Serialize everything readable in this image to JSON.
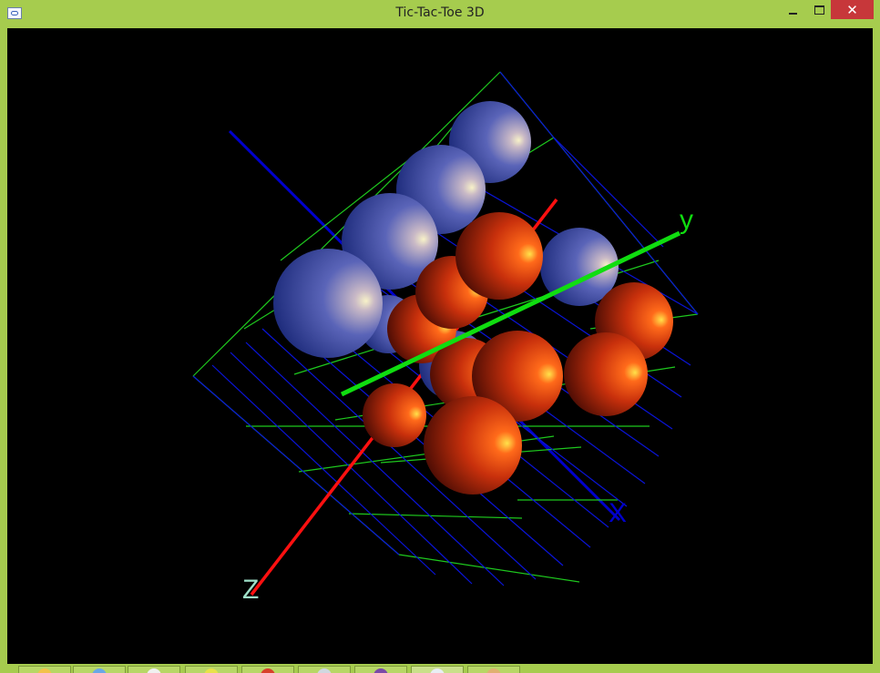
{
  "window": {
    "title": "Tic-Tac-Toe 3D",
    "controls": {
      "minimize": "minimize",
      "maximize": "maximize",
      "close": "✕"
    }
  },
  "scene": {
    "background": "#000000",
    "axis_labels": {
      "x": "X",
      "y": "y",
      "z": "Z"
    },
    "colors": {
      "x_axis": "#0000cc",
      "y_axis": "#00dd00",
      "z_axis": "#ff1010",
      "grid_blue": "#0a14d8",
      "grid_green": "#1ec81e",
      "player_blue": "#4a57b8",
      "player_red": "#d8300e"
    },
    "pieces": [
      {
        "player": "blue"
      },
      {
        "player": "blue"
      },
      {
        "player": "blue"
      },
      {
        "player": "blue"
      },
      {
        "player": "blue"
      },
      {
        "player": "blue"
      },
      {
        "player": "blue"
      },
      {
        "player": "red"
      },
      {
        "player": "red"
      },
      {
        "player": "red"
      },
      {
        "player": "red"
      },
      {
        "player": "red"
      },
      {
        "player": "red"
      },
      {
        "player": "red"
      },
      {
        "player": "red"
      },
      {
        "player": "red"
      }
    ]
  },
  "taskbar": {
    "items": [
      {
        "icon": "ie-icon"
      },
      {
        "icon": "folder-icon"
      },
      {
        "icon": "chrome-icon"
      },
      {
        "icon": "document-icon"
      },
      {
        "icon": "visual-studio-icon"
      },
      {
        "icon": "window-icon"
      },
      {
        "icon": "paint-icon"
      }
    ]
  }
}
